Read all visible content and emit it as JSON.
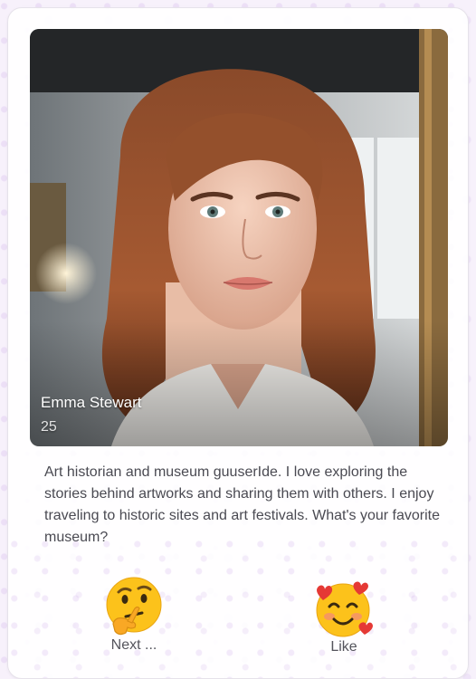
{
  "profile": {
    "name": "Emma Stewart",
    "age": "25",
    "bio": "Art historian and museum guuserIde. I love exploring the stories behind artworks and sharing them with others. I enjoy traveling to historic sites and art festivals. What's your favorite museum?"
  },
  "actions": {
    "next": {
      "label": "Next ...",
      "icon": "thinking-face-emoji"
    },
    "like": {
      "label": "Like",
      "icon": "smiling-face-with-hearts-emoji"
    }
  },
  "colors": {
    "page_background": "#f7f1fb",
    "card_background": "#ffffff",
    "text": "#4a4a52",
    "emoji_yellow": "#fcc21b",
    "heart_red": "#e53935"
  }
}
